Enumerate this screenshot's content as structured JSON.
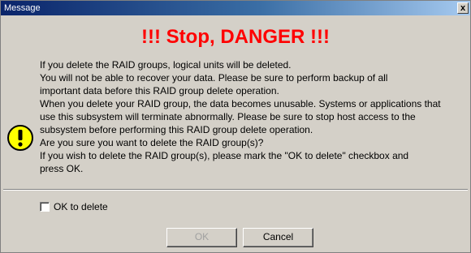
{
  "window": {
    "title": "Message",
    "close_glyph": "x"
  },
  "dialog": {
    "heading": "!!! Stop, DANGER !!!",
    "icon": "warning-icon",
    "heading_color": "#ff0000",
    "message_lines": [
      "If you delete the RAID groups, logical units will be deleted.",
      "You will not be able to recover your data. Please be sure to perform backup of all",
      "important data before this RAID group delete operation.",
      "When you delete your RAID group, the data becomes unusable. Systems or applications that",
      "use this subsystem will terminate abnormally. Please be sure to stop host access to the",
      "subsystem before performing this RAID group delete operation.",
      "Are you sure you want to delete the RAID group(s)?",
      "If you wish to delete the RAID group(s), please mark the \"OK to delete\" checkbox and",
      "press OK."
    ],
    "confirm_checkbox": {
      "label": "OK to delete",
      "checked": false
    },
    "buttons": {
      "ok_label": "OK",
      "ok_enabled": false,
      "cancel_label": "Cancel"
    }
  }
}
